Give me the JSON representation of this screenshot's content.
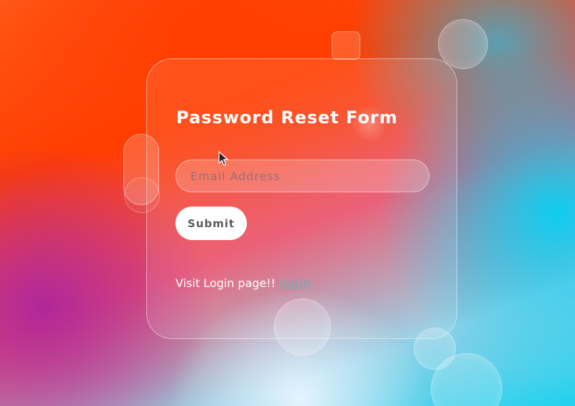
{
  "form": {
    "title": "Password Reset Form",
    "email_placeholder": "Email Address",
    "email_value": "",
    "submit_label": "Submit",
    "footer_text": "Visit Login page!! ",
    "login_link_label": "login"
  },
  "colors": {
    "background_top": "#ff3d00",
    "background_left": "#b1279a",
    "background_right": "#0fcdf0",
    "text": "#ffffff",
    "button_bg": "#ffffff",
    "button_text": "#5a5a5a",
    "link": "#8fa1aa"
  },
  "icons": {
    "cursor": "mouse-pointer-icon"
  }
}
